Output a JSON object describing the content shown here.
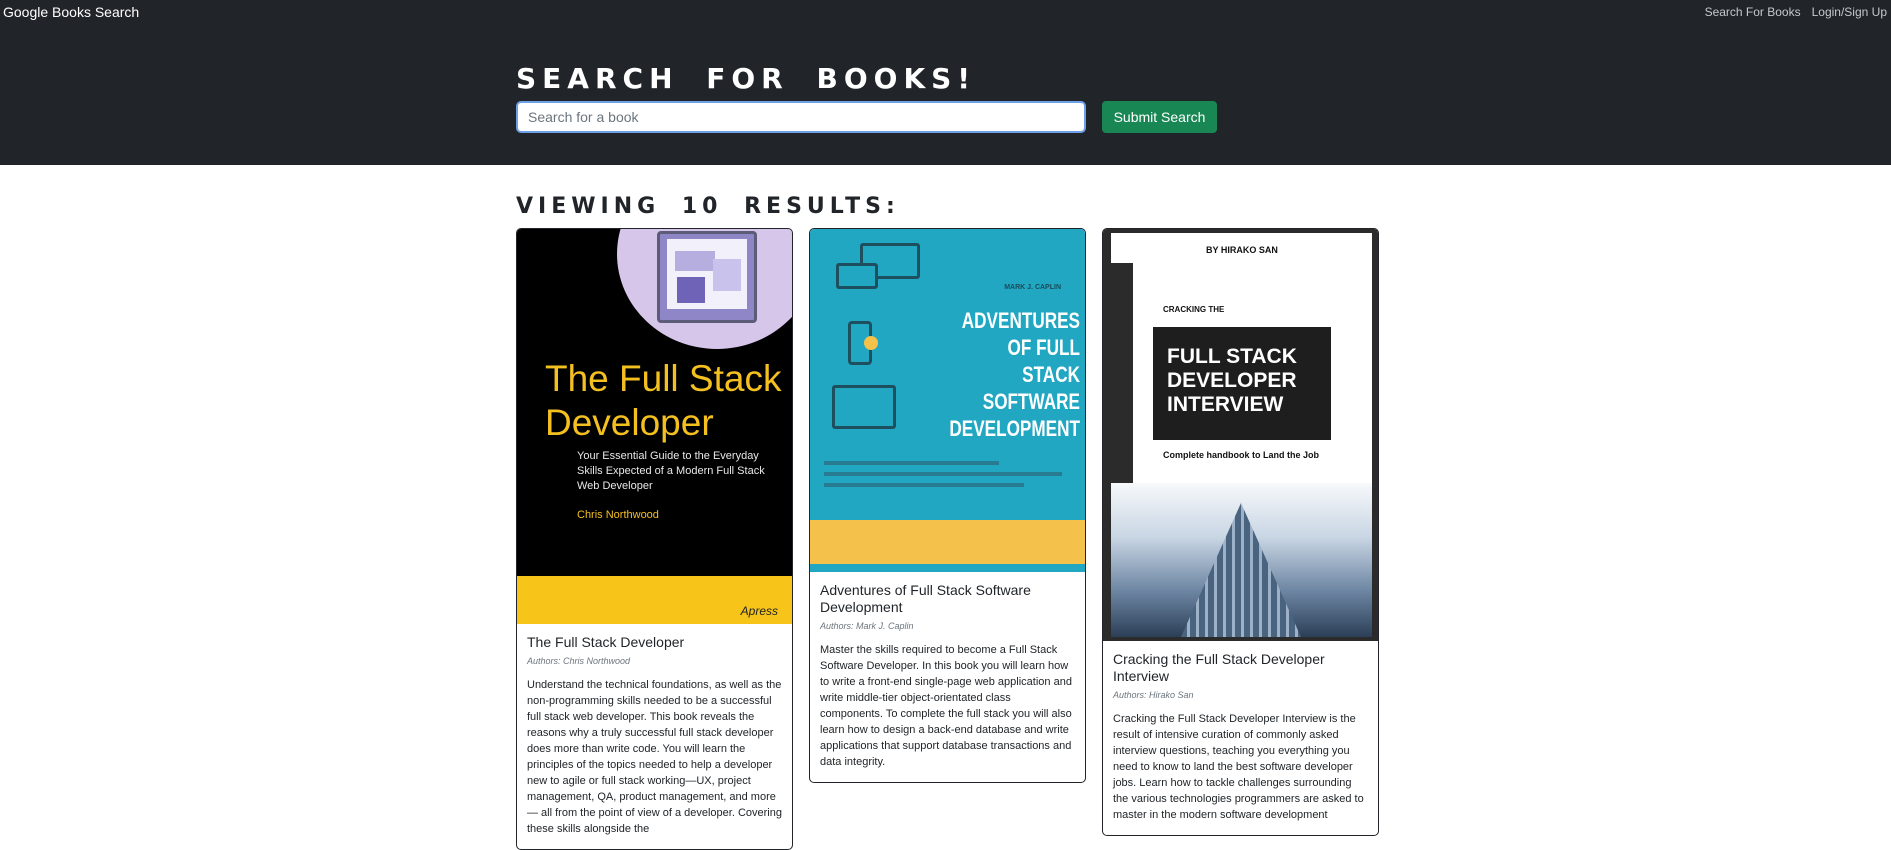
{
  "navbar": {
    "brand": "Google Books Search",
    "links": [
      "Search For Books",
      "Login/Sign Up"
    ]
  },
  "hero": {
    "title": "Search for Books!",
    "search_placeholder": "Search for a book",
    "search_value": "",
    "submit_label": "Submit Search"
  },
  "results": {
    "title": "Viewing 10 results:"
  },
  "books": [
    {
      "title": "The Full Stack Developer",
      "authors": "Authors: Chris Northwood",
      "description": "Understand the technical foundations, as well as the non-programming skills needed to be a successful full stack web developer. This book reveals the reasons why a truly successful full stack developer does more than write code. You will learn the principles of the topics needed to help a developer new to agile or full stack working—UX, project management, QA, product management, and more— all from the point of view of a developer. Covering these skills alongside the",
      "cover": {
        "title": "The Full Stack Developer",
        "subtitle": "Your Essential Guide to the Everyday Skills Expected of a Modern Full Stack Web Developer",
        "author": "Chris Northwood",
        "publisher": "Apress"
      }
    },
    {
      "title": "Adventures of Full Stack Software Development",
      "authors": "Authors: Mark J. Caplin",
      "description": "Master the skills required to become a Full Stack Software Developer. In this book you will learn how to write a front-end single-page web application and write middle-tier object-orientated class components. To complete the full stack you will also learn how to design a back-end database and write applications that support database transactions and data integrity.",
      "cover": {
        "title": "ADVENTURES OF FULL STACK SOFTWARE DEVELOPMENT",
        "author": "MARK J. CAPLIN"
      }
    },
    {
      "title": "Cracking the Full Stack Developer Interview",
      "authors": "Authors: Hirako San",
      "description": "Cracking the Full Stack Developer Interview is the result of intensive curation of commonly asked interview questions, teaching you everything you need to know to land the best software developer jobs. Learn how to tackle challenges surrounding the various technologies programmers are asked to master in the modern software development",
      "cover": {
        "by": "BY HIRAKO SAN",
        "prefix": "CRACKING THE",
        "title": "FULL STACK DEVELOPER INTERVIEW",
        "subtitle": "Complete handbook to Land the Job"
      }
    }
  ]
}
